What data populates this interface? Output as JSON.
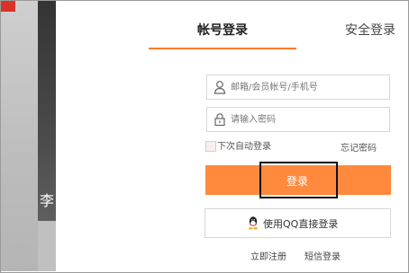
{
  "tabs": {
    "account_login": "帐号登录",
    "secure_login": "安全登录"
  },
  "form": {
    "username_placeholder": "邮箱/会员帐号/手机号",
    "password_placeholder": "请输入密码",
    "auto_login_label": "下次自动登录",
    "forgot_password": "忘记密码",
    "login_button": "登录",
    "qq_login_button": "使用QQ直接登录"
  },
  "footer": {
    "register": "立即注册",
    "sms_login": "短信登录"
  },
  "background": {
    "partial_char": "李"
  },
  "colors": {
    "accent": "#ff8a3d",
    "tab_underline": "#ff7a2a"
  }
}
